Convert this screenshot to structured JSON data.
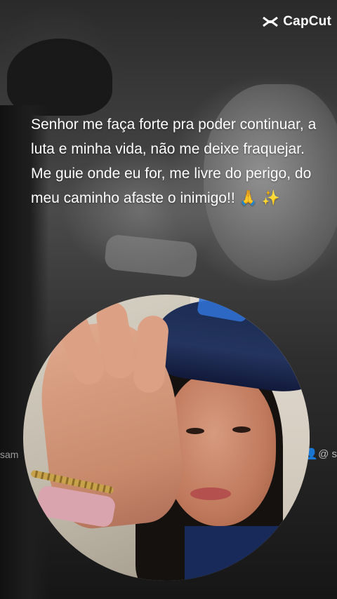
{
  "brand": {
    "name": "CapCut",
    "icon": "capcut-logo-icon",
    "color": "#ffffff"
  },
  "quote": {
    "text": "Senhor me faça forte pra poder continuar, a luta e minha vida, não me deixe fraquejar. Me guie onde eu for, me livre do perigo, do meu caminho afaste o inimigo!! 🙏 ✨"
  },
  "background": {
    "left_fragment": "sam",
    "right_fragment": "👤@ s"
  },
  "photo": {
    "description_icon": "portrait-photo",
    "accent_colors": {
      "cap": "#1b2b52",
      "cap_logo": "#2f6fd0",
      "watch_band": "#d9a4ae"
    }
  }
}
